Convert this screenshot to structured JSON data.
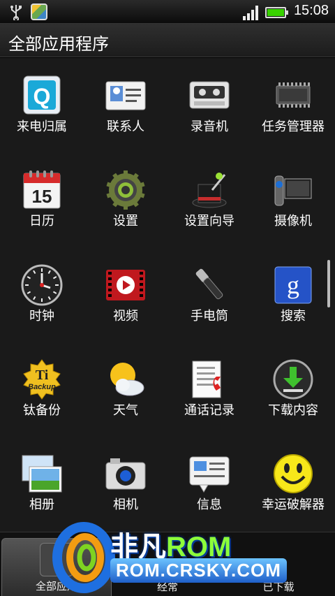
{
  "status_bar": {
    "time": "15:08",
    "battery_level": 1.0
  },
  "title": "全部应用程序",
  "apps": [
    {
      "label": "来电归属",
      "icon": "q-caller-id-icon"
    },
    {
      "label": "联系人",
      "icon": "contacts-card-icon"
    },
    {
      "label": "录音机",
      "icon": "cassette-recorder-icon"
    },
    {
      "label": "任务管理器",
      "icon": "chip-task-manager-icon"
    },
    {
      "label": "日历",
      "icon": "calendar-icon",
      "day": "15"
    },
    {
      "label": "设置",
      "icon": "gear-settings-icon"
    },
    {
      "label": "设置向导",
      "icon": "magic-hat-wizard-icon"
    },
    {
      "label": "摄像机",
      "icon": "camcorder-icon"
    },
    {
      "label": "时钟",
      "icon": "clock-icon"
    },
    {
      "label": "视频",
      "icon": "video-play-icon"
    },
    {
      "label": "手电筒",
      "icon": "flashlight-icon"
    },
    {
      "label": "搜索",
      "icon": "google-search-icon",
      "glyph": "g"
    },
    {
      "label": "钛备份",
      "icon": "titanium-backup-icon",
      "glyph": "Ti",
      "subglyph": "Backup"
    },
    {
      "label": "天气",
      "icon": "weather-sun-cloud-icon"
    },
    {
      "label": "通话记录",
      "icon": "call-log-icon"
    },
    {
      "label": "下载内容",
      "icon": "download-arrow-icon"
    },
    {
      "label": "相册",
      "icon": "photo-album-icon"
    },
    {
      "label": "相机",
      "icon": "camera-icon"
    },
    {
      "label": "信息",
      "icon": "message-bubble-icon"
    },
    {
      "label": "幸运破解器",
      "icon": "smiley-lucky-patcher-icon"
    }
  ],
  "tabs": [
    {
      "label": "全部应用"
    },
    {
      "label": "经常"
    },
    {
      "label": "已下载"
    }
  ],
  "watermark": {
    "brand": "非凡ROM",
    "site": "ROM.CRSKY.COM"
  }
}
